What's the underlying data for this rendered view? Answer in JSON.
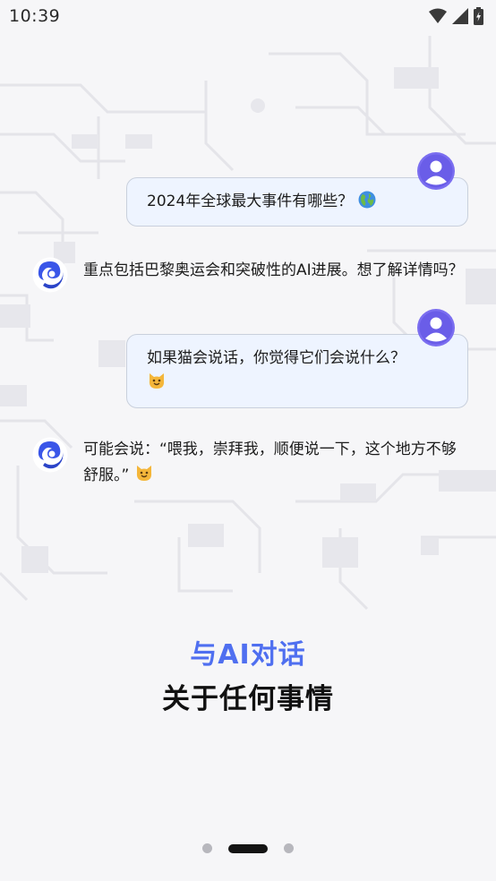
{
  "status": {
    "time": "10:39"
  },
  "chat": {
    "messages": [
      {
        "role": "user",
        "text": "2024年全球最大事件有哪些？",
        "emoji": "globe"
      },
      {
        "role": "ai",
        "text": "重点包括巴黎奥运会和突破性的AI进展。想了解详情吗？"
      },
      {
        "role": "user",
        "text": "如果猫会说话，你觉得它们会说什么？",
        "emoji": "cat"
      },
      {
        "role": "ai",
        "text": "可能会说：“喂我，崇拜我，顺便说一下，这个地方不够舒服。”",
        "emoji": "cat"
      }
    ]
  },
  "headline": {
    "accent": "与AI对话",
    "main": "关于任何事情"
  },
  "pager": {
    "page_count": 3,
    "active_index": 1
  },
  "colors": {
    "accent": "#4f6ff0",
    "user_bubble": "#eef4ff",
    "user_avatar": "#7b6ef0",
    "ai_logo": "#3a56e8"
  }
}
